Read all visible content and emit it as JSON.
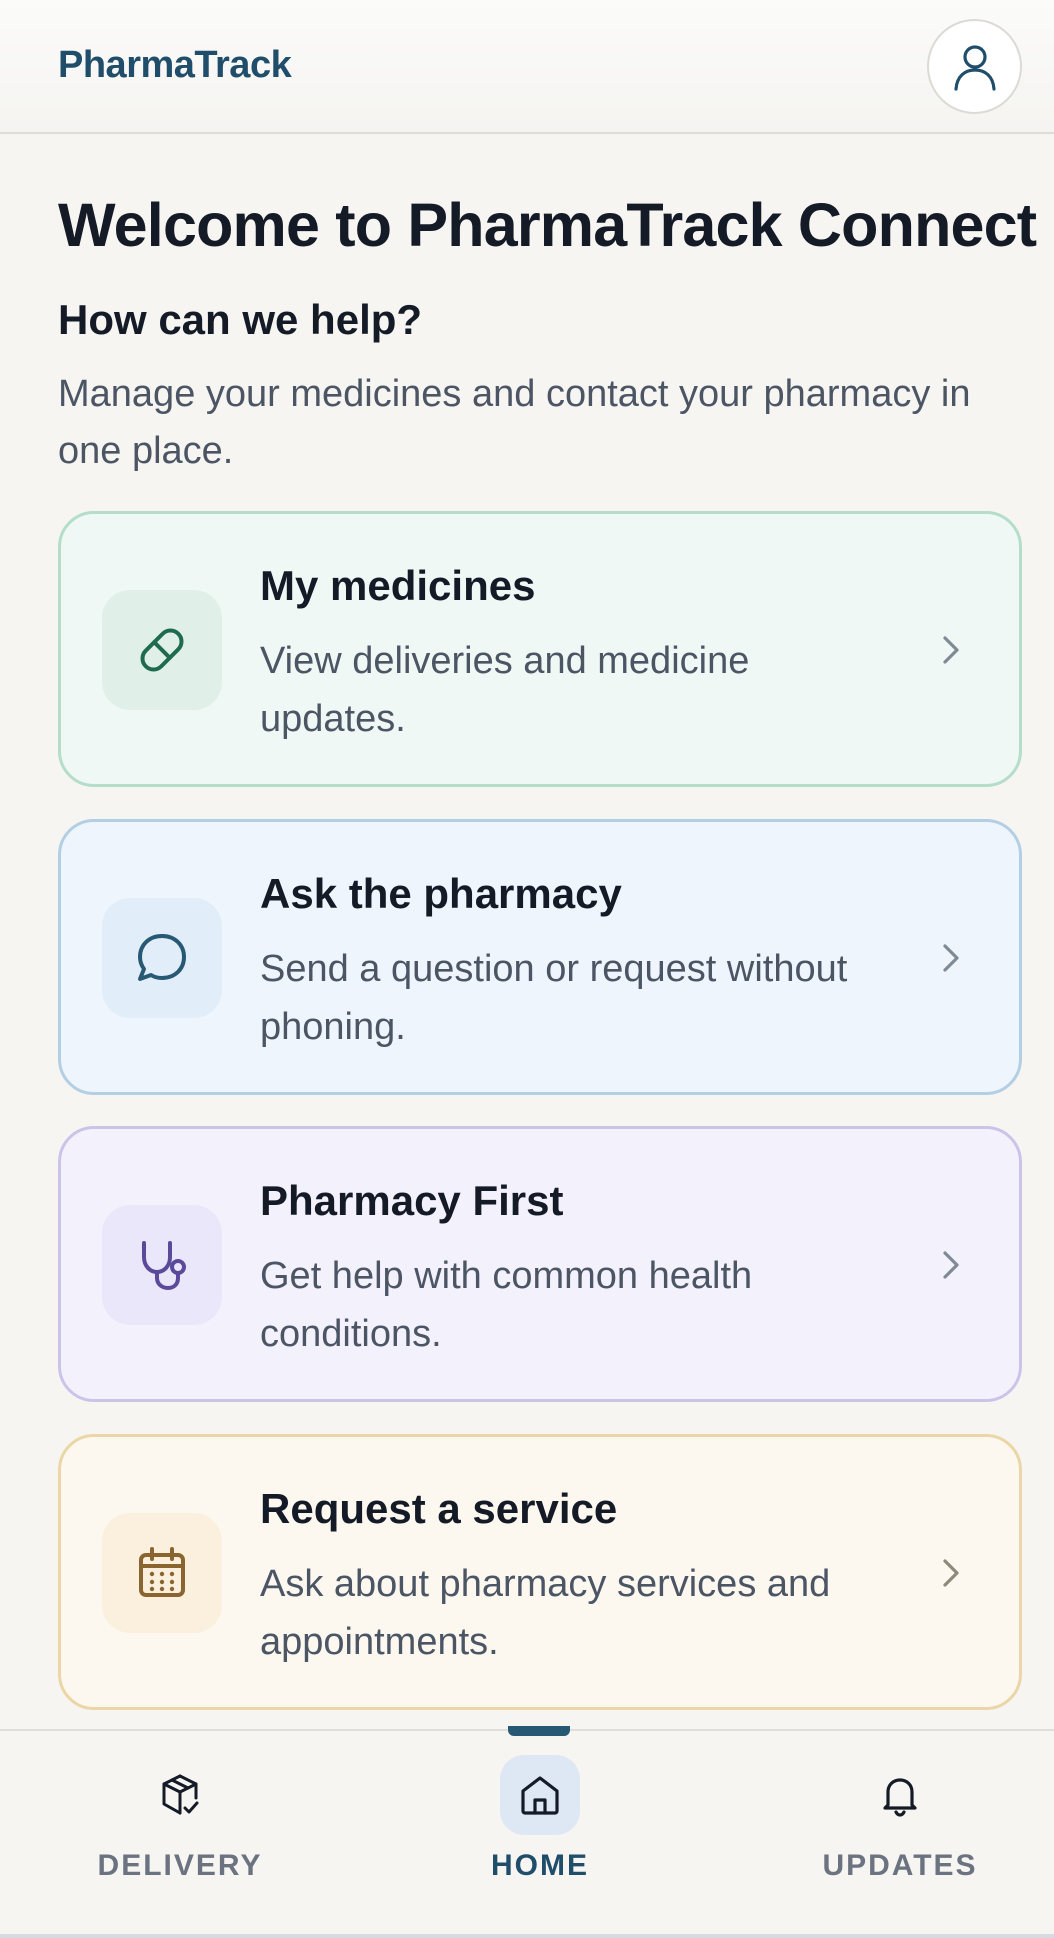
{
  "header": {
    "brand": "PharmaTrack",
    "profile_icon": "user-icon"
  },
  "main": {
    "title": "Welcome to PharmaTrack Connect",
    "subtitle": "How can we help?",
    "intro": "Manage your medicines and contact your pharmacy in one place.",
    "cards": [
      {
        "title": "My medicines",
        "description": "View deliveries and medicine updates.",
        "icon": "pill-icon",
        "accent": "#1f6b4f"
      },
      {
        "title": "Ask the pharmacy",
        "description": "Send a question or request without phoning.",
        "icon": "chat-bubble-icon",
        "accent": "#275874"
      },
      {
        "title": "Pharmacy First",
        "description": "Get help with common health conditions.",
        "icon": "stethoscope-icon",
        "accent": "#5b4a9a"
      },
      {
        "title": "Request a service",
        "description": "Ask about pharmacy services and appointments.",
        "icon": "calendar-icon",
        "accent": "#8a6530"
      }
    ]
  },
  "bottom_nav": {
    "items": [
      {
        "label": "DELIVERY",
        "icon": "package-check-icon",
        "active": false
      },
      {
        "label": "HOME",
        "icon": "home-icon",
        "active": true
      },
      {
        "label": "UPDATES",
        "icon": "bell-icon",
        "active": false
      }
    ]
  },
  "colors": {
    "brand": "#1f4d6a",
    "text": "#141b27",
    "muted": "#4b5564",
    "background": "#f6f5f2"
  }
}
